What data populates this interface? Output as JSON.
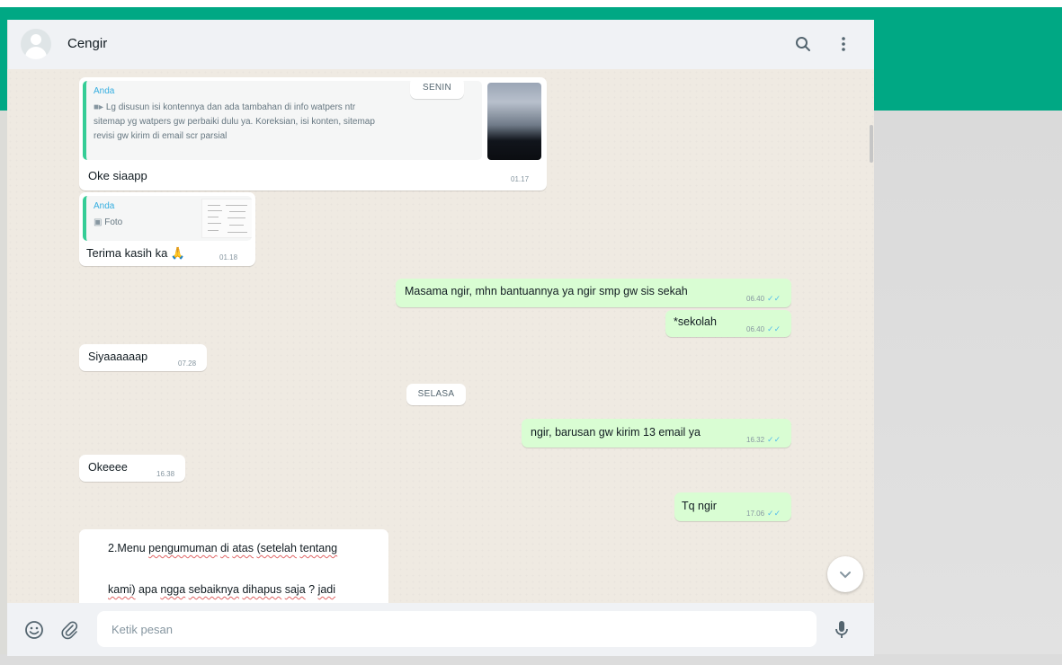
{
  "header": {
    "contact_name": "Cengir",
    "icons": {
      "avatar": "default-avatar",
      "search": "search-icon",
      "menu": "menu-dots-icon"
    }
  },
  "messages": {
    "date_senin": "SENIN",
    "m1": {
      "quote_author": "Anda",
      "quote_text_1": "Lg disusun isi kontennya dan ada tambahan di info watpers ntr",
      "quote_text_2": "sitemap yg watpers gw perbaiki dulu ya. Koreksian, isi konten, sitemap",
      "quote_text_3": "revisi gw kirim di email scr parsial",
      "text": "Oke siaapp",
      "time": "01.17"
    },
    "m2": {
      "quote_author": "Anda",
      "quote_media": "Foto",
      "text": "Terima kasih ka 🙏",
      "time": "01.18"
    },
    "m3": {
      "text": "Masama ngir, mhn bantuannya ya ngir smp gw sis sekah",
      "time": "06.40"
    },
    "m4": {
      "text": "*sekolah",
      "time": "06.40"
    },
    "m5": {
      "text": "Siyaaaaaap",
      "time": "07.28"
    },
    "date_selasa": "SELASA",
    "m6": {
      "text": "ngir, barusan gw kirim 13 email ya",
      "time": "16.32"
    },
    "m7": {
      "text": "Okeeee",
      "time": "16.38"
    },
    "m8": {
      "text": "Tq ngir",
      "time": "17.06"
    },
    "m9": {
      "line1_a": "2.Menu ",
      "line1_b": "pengumuman",
      "line1_c": " ",
      "line1_d": "di",
      "line1_e": " ",
      "line1_f": "atas",
      "line1_g": " ",
      "line1_h": "(setelah",
      "line1_i": " ",
      "line1_j": "tentang",
      "line2_a": "kami)",
      "line2_b": " apa ",
      "line2_c": "ngga",
      "line2_d": " ",
      "line2_e": "sebaiknya",
      "line2_f": " ",
      "line2_g": "dihapus",
      "line2_h": " ",
      "line2_i": "saja",
      "line2_j": " ? ",
      "line2_k": "jadi"
    },
    "ticks": "✓✓"
  },
  "composer": {
    "placeholder": "Ketik pesan",
    "icons": {
      "emoji": "emoji-icon",
      "attach": "paperclip-icon",
      "mic": "microphone-icon"
    }
  }
}
